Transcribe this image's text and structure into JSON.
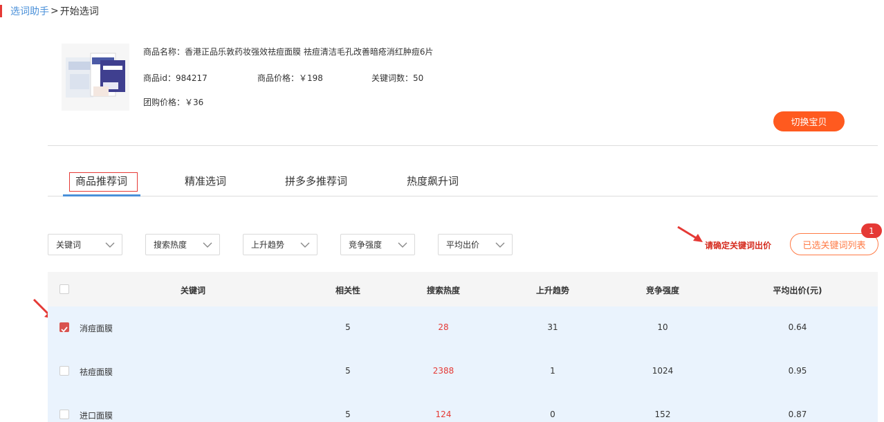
{
  "breadcrumb": {
    "link": "选词助手",
    "separator": ">",
    "current": "开始选词"
  },
  "product": {
    "name": "商品名称：香港正品乐敦药妆强效祛痘面膜 祛痘清洁毛孔改善暗疮消红肿痘6片",
    "id": "商品id：984217",
    "price": "商品价格：￥198",
    "keyword_count": "关键词数：50",
    "group_price": "团购价格：￥36",
    "switch_label": "切换宝贝"
  },
  "tabs": [
    {
      "label": "商品推荐词",
      "active": true
    },
    {
      "label": "精准选词",
      "active": false
    },
    {
      "label": "拼多多推荐词",
      "active": false
    },
    {
      "label": "热度飙升词",
      "active": false
    }
  ],
  "filters": [
    "关键词",
    "搜索热度",
    "上升趋势",
    "竞争强度",
    "平均出价"
  ],
  "confirm_text": "请确定关键词出价",
  "selected_list": {
    "label": "已选关键词列表",
    "count": "1"
  },
  "table": {
    "columns": [
      "关键词",
      "相关性",
      "搜索热度",
      "上升趋势",
      "竞争强度",
      "平均出价(元)"
    ],
    "rows": [
      {
        "keyword": "消痘面膜",
        "relevance": "5",
        "heat": "28",
        "trend": "31",
        "competition": "10",
        "avg_bid": "0.64",
        "checked": true
      },
      {
        "keyword": "祛痘面膜",
        "relevance": "5",
        "heat": "2388",
        "trend": "1",
        "competition": "1024",
        "avg_bid": "0.95",
        "checked": false
      },
      {
        "keyword": "进口面膜",
        "relevance": "5",
        "heat": "124",
        "trend": "0",
        "competition": "152",
        "avg_bid": "0.87",
        "checked": false
      }
    ]
  },
  "colors": {
    "accent": "#ff5a1f",
    "link": "#4a90d9",
    "alert": "#e53935",
    "row_highlight": "#eaf3fd"
  }
}
